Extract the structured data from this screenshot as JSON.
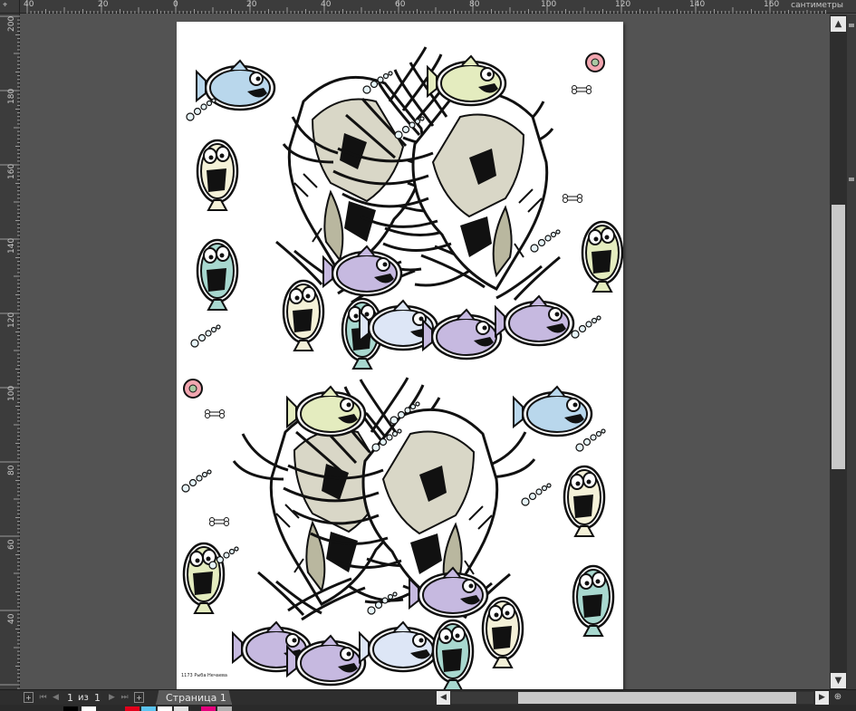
{
  "ruler": {
    "unit": "сантиметры",
    "top_labels": [
      "40",
      "20",
      "0",
      "20",
      "40",
      "60",
      "80",
      "100",
      "120",
      "140",
      "160"
    ],
    "left_labels": [
      "200",
      "180",
      "160",
      "140",
      "120",
      "100",
      "80",
      "60",
      "40"
    ]
  },
  "page": {
    "caption": "1173 Рыба Нечаева"
  },
  "navigation": {
    "current_page": "1",
    "of_label": "из",
    "total_pages": "1",
    "page_tab_label": "Страница 1"
  },
  "icons": {
    "corner": "ruler-origin-icon",
    "first": "first-page-icon",
    "prev": "prev-page-icon",
    "next": "next-page-icon",
    "last": "last-page-icon",
    "add_before": "add-page-icon",
    "add_after": "add-page-icon",
    "scroll_up": "chevron-up-icon",
    "scroll_down": "chevron-down-icon",
    "scroll_left": "chevron-left-icon",
    "scroll_right": "chevron-right-icon",
    "zoom": "zoom-icon"
  },
  "palette_colors": [
    "#000000",
    "#ffffff",
    "#e3001b",
    "#5bc5f2",
    "#ffffff",
    "#e2e2e2",
    "#e5007d",
    "#b0b0b0"
  ]
}
